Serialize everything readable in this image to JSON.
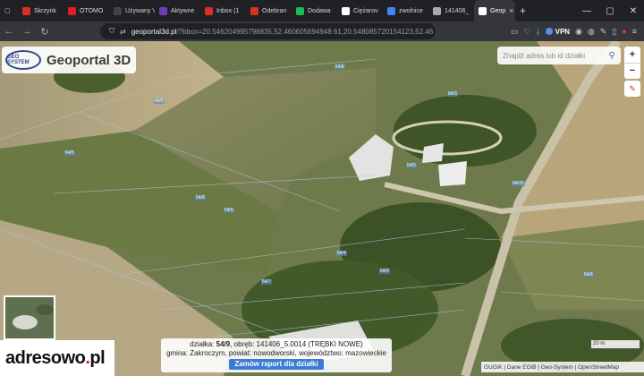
{
  "browser": {
    "tabs": [
      {
        "label": "Skrzynk",
        "color": "#d93025",
        "active": false
      },
      {
        "label": "OTOMO",
        "color": "#e02020",
        "active": false
      },
      {
        "label": "Używany Vo",
        "color": "#444444",
        "active": false
      },
      {
        "label": "Aktywne",
        "color": "#6a3fb5",
        "active": false
      },
      {
        "label": "Inbox (1",
        "color": "#d93025",
        "active": false
      },
      {
        "label": "Odebran",
        "color": "#d93025",
        "active": false
      },
      {
        "label": "Dodawa",
        "color": "#1db954",
        "active": false
      },
      {
        "label": "Ciężarov",
        "color": "#ffffff",
        "active": false
      },
      {
        "label": "zwolnice",
        "color": "#4285f4",
        "active": false
      },
      {
        "label": "141406_",
        "color": "#aaaaaa",
        "active": false
      },
      {
        "label": "Geop",
        "color": "#ffffff",
        "active": true
      }
    ],
    "url_host": "geoportal3d.pl",
    "url_path": "/?bbox=20.546204995796835,52.460605694948 61,20.548085720154123,52.46",
    "vpn_label": "VPN"
  },
  "app": {
    "title": "Geoportal 3D",
    "geosystem_logo_text": "GEO SYSTEM",
    "search_placeholder": "Znajdź adres lub id działki",
    "zoom_in": "+",
    "zoom_out": "−"
  },
  "parcel_labels": [
    {
      "text": "64/9"
    },
    {
      "text": "64/8"
    },
    {
      "text": "64/3"
    },
    {
      "text": "64/5"
    },
    {
      "text": "54/8"
    },
    {
      "text": "54/6"
    },
    {
      "text": "54/4"
    },
    {
      "text": "54/9"
    },
    {
      "text": "54/7"
    },
    {
      "text": "64/10"
    },
    {
      "text": "64/6"
    },
    {
      "text": "54/5"
    }
  ],
  "parcel_info": {
    "line1_prefix": "działka:",
    "parcel_number": "54/9",
    "line1_suffix": ", obręb: 141406_5.0014 (TRĘBKI NOWE)",
    "line2": "gmina: Zakroczym, powiat: nowodworski, województwo: mazowieckie",
    "report_button": "Zamów raport dla działki"
  },
  "scale_label": "20 m",
  "attribution": "GUGiK | Dane EGiB | Geo-System | OpenStreetMap",
  "watermark": {
    "text_main": "adresowo",
    "text_dot": ".",
    "text_tld": "pl"
  }
}
